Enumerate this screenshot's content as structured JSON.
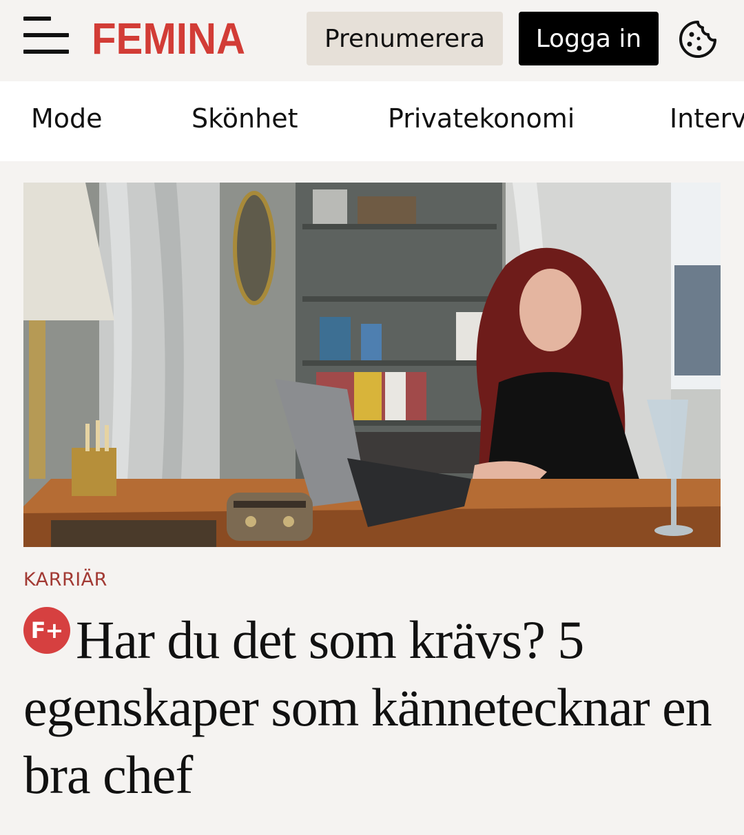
{
  "header": {
    "brand": "FEMINA",
    "subscribe_label": "Prenumerera",
    "login_label": "Logga in",
    "menu_icon": "hamburger-menu-icon",
    "cookie_icon": "cookie-icon",
    "brand_color": "#d23c36"
  },
  "nav": {
    "items": [
      {
        "label": "Mode"
      },
      {
        "label": "Skönhet"
      },
      {
        "label": "Privatekonomi"
      },
      {
        "label": "Interv"
      }
    ]
  },
  "article": {
    "category": "KARRIÄR",
    "badge": "F+",
    "headline": "Har du det som krävs? 5 egenskaper som kännetecknar en bra chef",
    "category_color": "#a23a34"
  }
}
